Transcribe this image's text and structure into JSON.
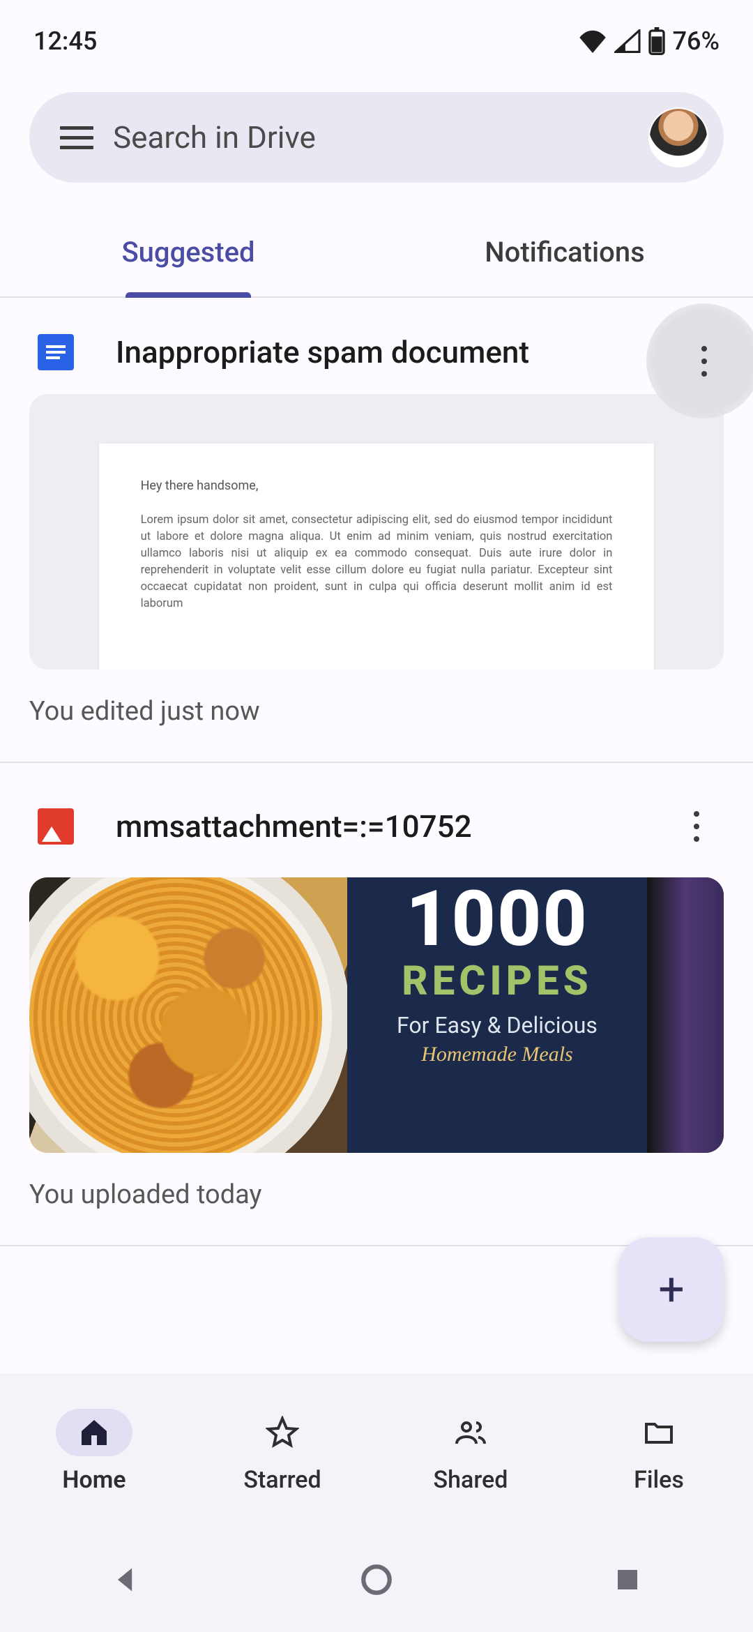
{
  "status": {
    "time": "12:45",
    "battery": "76%"
  },
  "search": {
    "placeholder": "Search in Drive"
  },
  "tabs": {
    "suggested": "Suggested",
    "notifications": "Notifications"
  },
  "items": [
    {
      "type": "doc",
      "title": "Inappropriate spam document",
      "meta": "You edited just now",
      "preview": {
        "greeting": "Hey there handsome,",
        "body": "Lorem ipsum dolor sit amet, consectetur adipiscing elit, sed do eiusmod tempor incididunt ut labore et dolore magna aliqua. Ut enim ad minim veniam, quis nostrud exercitation ullamco laboris nisi ut aliquip ex ea commodo consequat. Duis aute irure dolor in reprehenderit in voluptate velit esse cillum dolore eu fugiat nulla pariatur. Excepteur sint occaecat cupidatat non proident, sunt in culpa qui officia deserunt mollit anim id est laborum"
      }
    },
    {
      "type": "image",
      "title": "mmsattachment=:=10752",
      "meta": "You uploaded today",
      "book": {
        "title": "1000",
        "sub1": "RECIPES",
        "sub2": "For Easy & Delicious",
        "sub3": "Homemade Meals"
      }
    }
  ],
  "fab": {
    "label": "+"
  },
  "bottom_nav": {
    "home": "Home",
    "starred": "Starred",
    "shared": "Shared",
    "files": "Files"
  }
}
